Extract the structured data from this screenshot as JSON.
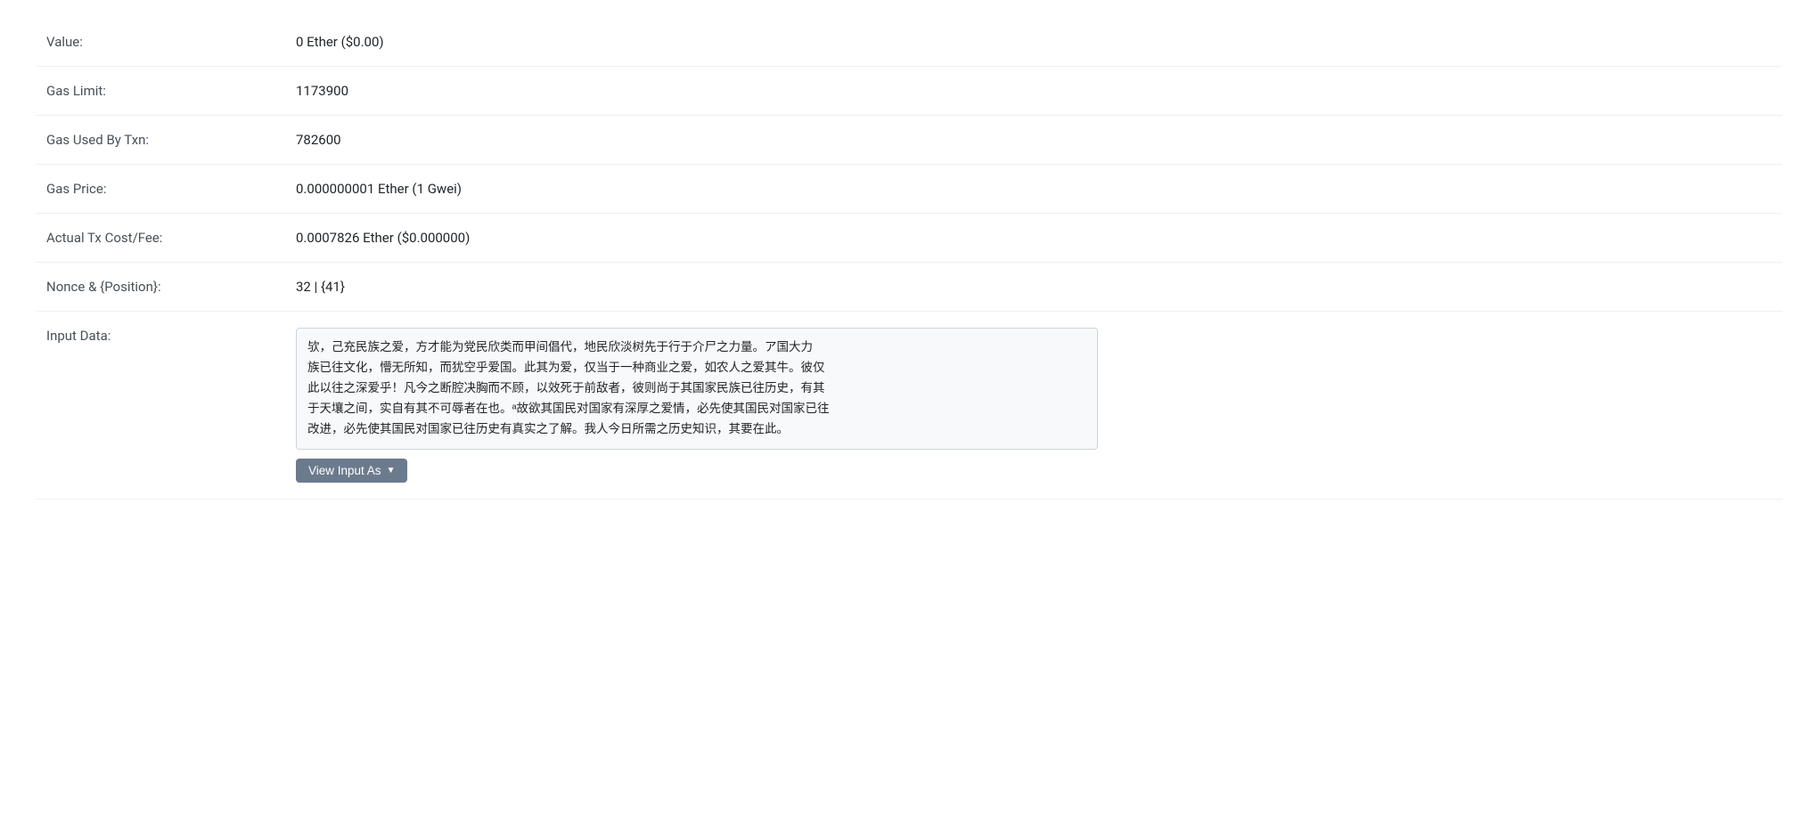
{
  "rows": [
    {
      "label": "Value:",
      "value": "0 Ether ($0.00)"
    },
    {
      "label": "Gas Limit:",
      "value": "1173900"
    },
    {
      "label": "Gas Used By Txn:",
      "value": "782600"
    },
    {
      "label": "Gas Price:",
      "value": "0.000000001 Ether (1 Gwei)"
    },
    {
      "label": "Actual Tx Cost/Fee:",
      "value": "0.0007826 Ether ($0.000000)"
    },
    {
      "label": "Nonce & {Position}:",
      "value": "32 | {41}"
    }
  ],
  "input_data": {
    "label": "Input Data:",
    "text": "欤，己充民族之爱，方才能为党民欣类而甲间倡代，地民欣淡树先于行于介尸之力量。ア国大力\n族已往文化，懵无所知，而犹空乎爱国。此其为爱，仅当于一种商业之爱，如农人之爱其牛。彼仅\n此以往之深爱乎！凡今之断腔决胸而不顾，以效死于前敌者，彼则尚于其国家民族已往历史，有其\n于天壤之间，实自有其不可辱者在也。ᵃ故欲其国民对国家有深厚之爱情，必先使其国民对国家已往\n改进，必先使其国民对国家已往历史有真实之了解。我人今日所需之历史知识，其要在此。",
    "button_label": "View Input As",
    "button_icon": "▼"
  }
}
